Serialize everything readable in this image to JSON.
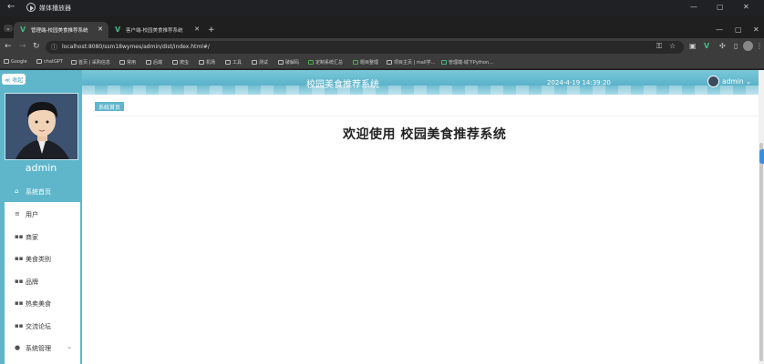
{
  "media_bar": {
    "title": "媒体播放器"
  },
  "tabs": [
    {
      "label": "管理端-校园美食推荐系统"
    },
    {
      "label": "客户端-校园美食推荐系统"
    }
  ],
  "address": {
    "url": "localhost:8080/ssm18wymes/admin/dist/index.html#/"
  },
  "bookmarks": [
    "Google",
    "chatGPT",
    "首页 | 采购信息",
    "常用",
    "后端",
    "爬虫",
    "机场",
    "工具",
    "测试",
    "破解码",
    "定制系统汇总",
    "题目整理",
    "项目主页 | mall学...",
    "管理端-城下Python..."
  ],
  "app": {
    "title": "校园美食推荐系统",
    "datetime": "2024-4-19 14:39:20",
    "user": "admin",
    "collapse_label": "≪ 收起",
    "admin_name": "admin",
    "breadcrumb": "系统首页",
    "welcome": "欢迎使用 校园美食推荐系统"
  },
  "menu": [
    {
      "label": "系统首页",
      "icon": "home-icon"
    },
    {
      "label": "用户",
      "icon": "list-icon"
    },
    {
      "label": "商家",
      "icon": "grid-icon"
    },
    {
      "label": "美食类别",
      "icon": "grid-icon"
    },
    {
      "label": "品牌",
      "icon": "grid-icon"
    },
    {
      "label": "热卖美食",
      "icon": "grid-icon"
    },
    {
      "label": "交流论坛",
      "icon": "grid-icon"
    },
    {
      "label": "系统管理",
      "icon": "person-icon"
    }
  ],
  "colors": {
    "accent": "#5fb6cb",
    "header": "#7ac7da"
  }
}
